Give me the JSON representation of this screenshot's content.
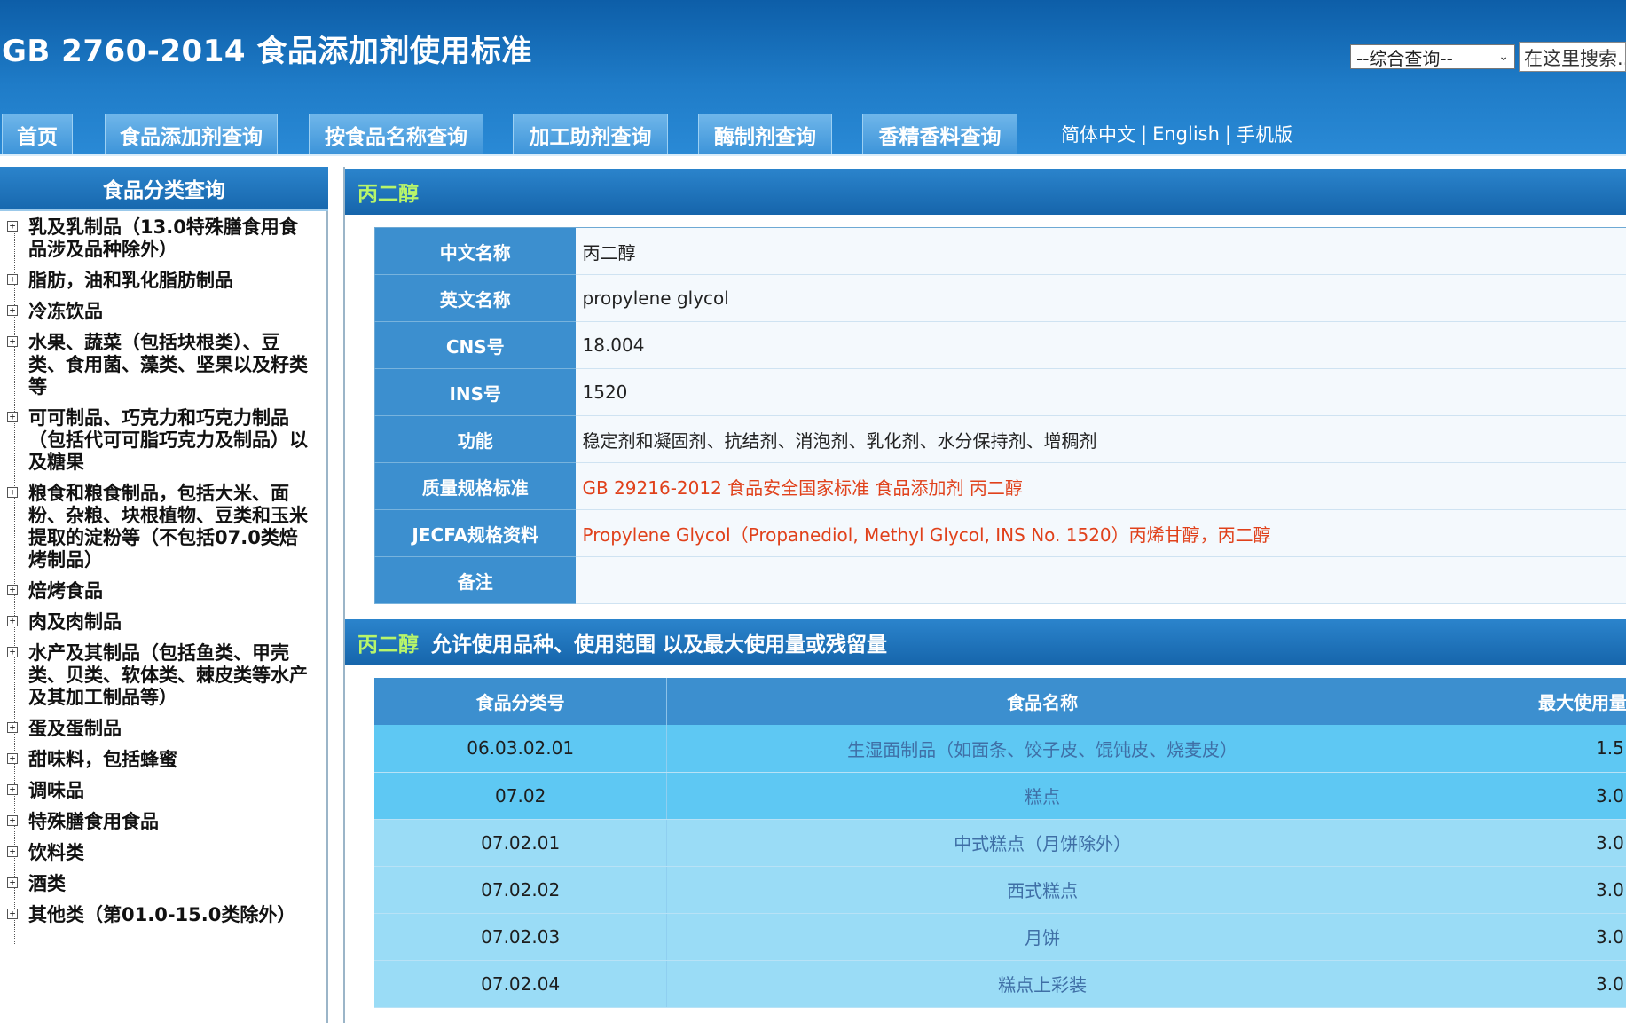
{
  "header": {
    "title": "GB 2760-2014 食品添加剂使用标准",
    "search_select": "--综合查询--",
    "search_placeholder": "在这里搜索..."
  },
  "nav": {
    "tabs": [
      {
        "label": "首页"
      },
      {
        "label": "食品添加剂查询"
      },
      {
        "label": "按食品名称查询"
      },
      {
        "label": "加工助剂查询"
      },
      {
        "label": "酶制剂查询"
      },
      {
        "label": "香精香料查询"
      }
    ],
    "lang_links": [
      "简体中文",
      "English",
      "手机版"
    ],
    "separator": "|"
  },
  "sidebar": {
    "title": "食品分类查询",
    "items": [
      "乳及乳制品（13.0特殊膳食用食品涉及品种除外）",
      "脂肪，油和乳化脂肪制品",
      "冷冻饮品",
      "水果、蔬菜（包括块根类）、豆类、食用菌、藻类、坚果以及籽类等",
      "可可制品、巧克力和巧克力制品（包括代可可脂巧克力及制品）以及糖果",
      "粮食和粮食制品，包括大米、面粉、杂粮、块根植物、豆类和玉米提取的淀粉等（不包括07.0类焙烤制品）",
      "焙烤食品",
      "肉及肉制品",
      "水产及其制品（包括鱼类、甲壳类、贝类、软体类、棘皮类等水产及其加工制品等）",
      "蛋及蛋制品",
      "甜味料，包括蜂蜜",
      "调味品",
      "特殊膳食用食品",
      "饮料类",
      "酒类",
      "其他类（第01.0-15.0类除外）"
    ]
  },
  "detail": {
    "title": "丙二醇",
    "rows": [
      {
        "key": "中文名称",
        "value": "丙二醇",
        "link": false
      },
      {
        "key": "英文名称",
        "value": "propylene glycol",
        "link": false
      },
      {
        "key": "CNS号",
        "value": "18.004",
        "link": false
      },
      {
        "key": "INS号",
        "value": "1520",
        "link": false
      },
      {
        "key": "功能",
        "value": "稳定剂和凝固剂、抗结剂、消泡剂、乳化剂、水分保持剂、增稠剂",
        "link": false
      },
      {
        "key": "质量规格标准",
        "value": "GB 29216-2012 食品安全国家标准 食品添加剂 丙二醇",
        "link": true
      },
      {
        "key": "JECFA规格资料",
        "value": "Propylene Glycol（Propanediol, Methyl Glycol, INS No. 1520）丙烯甘醇，丙二醇",
        "link": true
      },
      {
        "key": "备注",
        "value": "",
        "link": false
      }
    ]
  },
  "usage": {
    "title_highlight": "丙二醇",
    "title_rest": "允许使用品种、使用范围 以及最大使用量或残留量",
    "headers": [
      "食品分类号",
      "食品名称",
      "最大使用量"
    ],
    "rows": [
      {
        "code": "06.03.02.01",
        "name": "生湿面制品（如面条、饺子皮、馄饨皮、烧麦皮）",
        "max": "1.5"
      },
      {
        "code": "07.02",
        "name": "糕点",
        "max": "3.0"
      },
      {
        "code": "07.02.01",
        "name": "中式糕点（月饼除外）",
        "max": "3.0"
      },
      {
        "code": "07.02.02",
        "name": "西式糕点",
        "max": "3.0"
      },
      {
        "code": "07.02.03",
        "name": "月饼",
        "max": "3.0"
      },
      {
        "code": "07.02.04",
        "name": "糕点上彩装",
        "max": "3.0"
      }
    ]
  },
  "colors": {
    "header_blue": "#1f7cc8",
    "tab_blue": "#3d94d9",
    "highlight_green": "#b8f56a",
    "link_red": "#e0411b",
    "row_cyan": "#5ec8f3",
    "row_light_cyan": "#9adcf6"
  }
}
